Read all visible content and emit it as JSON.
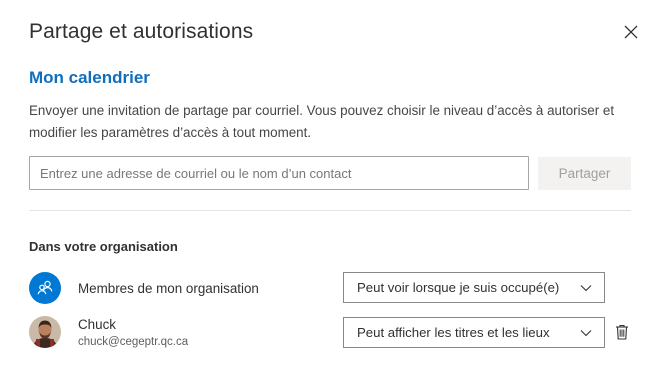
{
  "dialog": {
    "title": "Partage et autorisations",
    "close_icon": "close-icon"
  },
  "calendar": {
    "name": "Mon calendrier",
    "description": "Envoyer une invitation de partage par courriel. Vous pouvez choisir le niveau d’accès à autoriser et modifier les paramètres d’accès à tout moment."
  },
  "invite": {
    "placeholder": "Entrez une adresse de courriel ou le nom d’un contact",
    "value": "",
    "share_label": "Partager"
  },
  "organization": {
    "heading": "Dans votre organisation",
    "members_label": "Membres de mon organisation",
    "members_icon": "group-icon",
    "members_permission": "Peut voir lorsque je suis occupé(e)"
  },
  "contacts": [
    {
      "name": "Chuck",
      "email": "chuck@cegeptr.qc.ca",
      "permission": "Peut afficher les titres et les lieux",
      "remove_icon": "trash-icon"
    }
  ],
  "colors": {
    "accent": "#0078d4",
    "section_title": "#106ebe",
    "disabled_button_bg": "#f3f2f1",
    "disabled_button_text": "#a19f9d"
  }
}
